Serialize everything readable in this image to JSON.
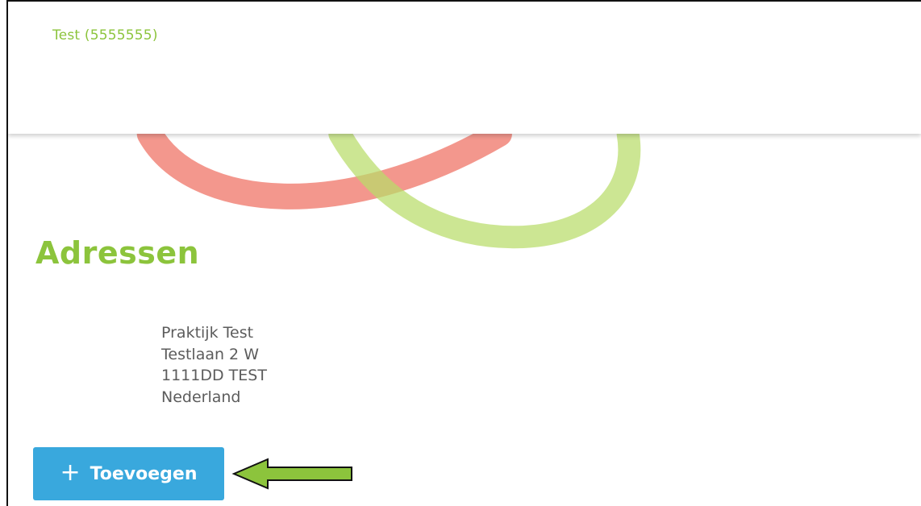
{
  "header": {
    "account_name": "Test (5555555)"
  },
  "page": {
    "title": "Adressen"
  },
  "address": {
    "lines": [
      "Praktijk Test",
      "Testlaan 2 W",
      "1111DD TEST",
      "Nederland"
    ]
  },
  "actions": {
    "add_label": "Toevoegen",
    "add_icon": "plus-icon"
  },
  "colors": {
    "brand_green": "#8cc43c",
    "button_blue": "#39a8dd",
    "decor_red": "#ee6f61",
    "decor_green": "#b8dc6a",
    "annotation_arrow": "#8cc43c",
    "text_gray": "#5c5c5c"
  }
}
